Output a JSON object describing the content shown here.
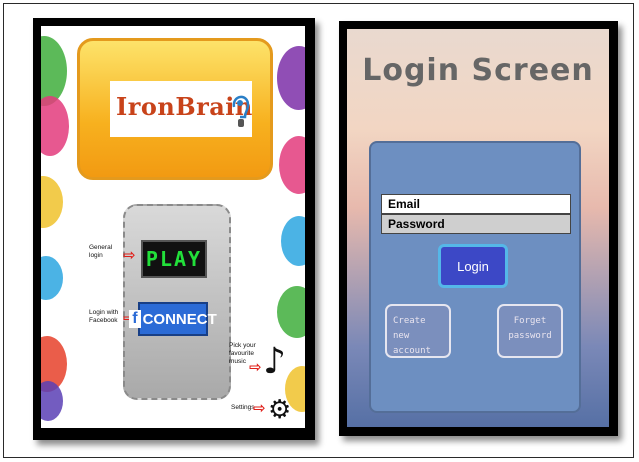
{
  "left_screen": {
    "logo_text": "IronBrain",
    "play_label": "PLAY",
    "connect_prefix": "f",
    "connect_label": "CONNECT",
    "general_login_label": "General login",
    "facebook_login_label": "Login with Facebook",
    "music_label": "Pick your favourite music",
    "settings_label": "Settings",
    "icons": [
      "brain-head-icon",
      "arrow-right-icon",
      "music-note-icon",
      "gear-icon"
    ]
  },
  "right_screen": {
    "title": "Login Screen",
    "email_label": "Email",
    "password_label": "Password",
    "login_label": "Login",
    "create_account_label": "Create new account",
    "forget_password_label": "Forget password"
  },
  "colors": {
    "play_text": "#22e03a",
    "facebook_blue": "#2b6bd6",
    "login_button": "#3c48c6",
    "login_panel": "#6d8fc1",
    "banner_orange": "#f7b11f",
    "arrow_red": "#e0201a"
  }
}
